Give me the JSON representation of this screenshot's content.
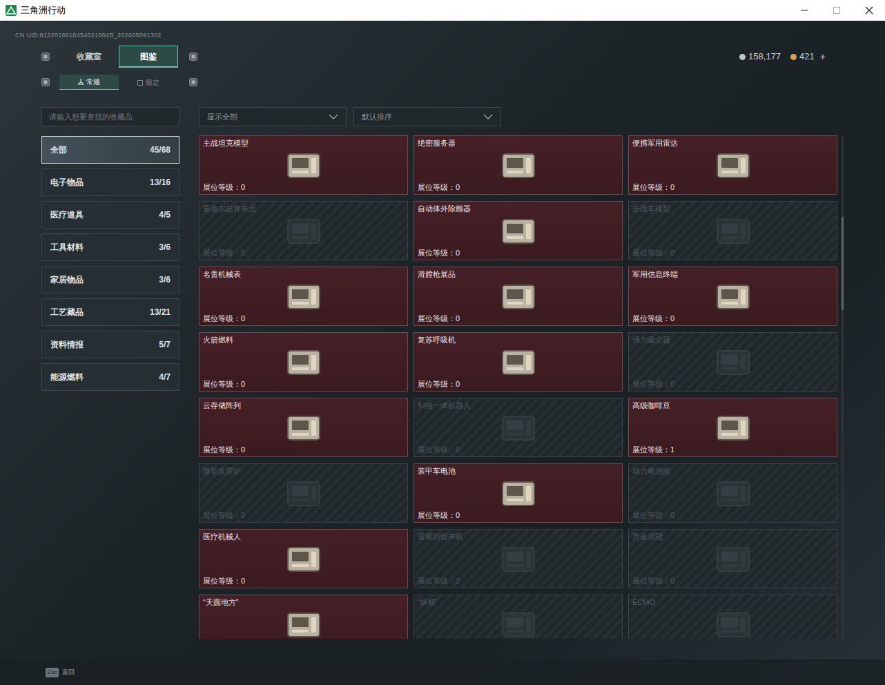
{
  "window": {
    "title": "三角洲行动"
  },
  "uid": "CN UID:8122816818454021804B_202605091302",
  "tabs": [
    {
      "label": "收藏室",
      "selected": false
    },
    {
      "label": "图鉴",
      "selected": true
    }
  ],
  "subtabs": [
    {
      "label": "常规",
      "selected": true
    },
    {
      "label": "限定",
      "selected": false
    }
  ],
  "currency": [
    {
      "amount": "158,177",
      "color": "#c0c4c6"
    },
    {
      "amount": "421",
      "color": "#d8a24a"
    }
  ],
  "currency_add": "+",
  "search": {
    "placeholder": "请输入想要查找的收藏品"
  },
  "filters": [
    {
      "label": "显示全部"
    },
    {
      "label": "默认排序"
    }
  ],
  "categories": [
    {
      "name": "全部",
      "count": "45/68",
      "selected": true
    },
    {
      "name": "电子物品",
      "count": "13/16",
      "selected": false
    },
    {
      "name": "医疗道具",
      "count": "4/5",
      "selected": false
    },
    {
      "name": "工具材料",
      "count": "3/6",
      "selected": false
    },
    {
      "name": "家居物品",
      "count": "3/6",
      "selected": false
    },
    {
      "name": "工艺藏品",
      "count": "13/21",
      "selected": false
    },
    {
      "name": "资料情报",
      "count": "5/7",
      "selected": false
    },
    {
      "name": "能源燃料",
      "count": "4/7",
      "selected": false
    }
  ],
  "items": [
    {
      "name": "主战坦克模型",
      "level": "展位等级：0",
      "collected": true
    },
    {
      "name": "绝密服务器",
      "level": "展位等级：0",
      "collected": true
    },
    {
      "name": "便携军用雷达",
      "level": "展位等级：0",
      "collected": true
    },
    {
      "name": "曼德尔超算单元",
      "level": "展位等级：0",
      "collected": false
    },
    {
      "name": "自动体外除颤器",
      "level": "展位等级：0",
      "collected": true
    },
    {
      "name": "步战车模型",
      "level": "展位等级：0",
      "collected": false
    },
    {
      "name": "名贵机械表",
      "level": "展位等级：0",
      "collected": true
    },
    {
      "name": "滑膛枪展品",
      "level": "展位等级：0",
      "collected": true
    },
    {
      "name": "军用信息终端",
      "level": "展位等级：0",
      "collected": true
    },
    {
      "name": "火箭燃料",
      "level": "展位等级：0",
      "collected": true
    },
    {
      "name": "复苏呼吸机",
      "level": "展位等级：0",
      "collected": true
    },
    {
      "name": "强力吸尘器",
      "level": "展位等级：0",
      "collected": false
    },
    {
      "name": "云存储阵列",
      "level": "展位等级：0",
      "collected": true
    },
    {
      "name": "扫拖一体机器人",
      "level": "展位等级：0",
      "collected": false
    },
    {
      "name": "高级咖啡豆",
      "level": "展位等级：1",
      "collected": true
    },
    {
      "name": "微型反应炉",
      "level": "展位等级：0",
      "collected": false
    },
    {
      "name": "装甲车电池",
      "level": "展位等级：0",
      "collected": true
    },
    {
      "name": "动力电池组",
      "level": "展位等级：0",
      "collected": false
    },
    {
      "name": "医疗机械人",
      "level": "展位等级：0",
      "collected": true
    },
    {
      "name": "雷斯的留声机",
      "level": "展位等级：0",
      "collected": false
    },
    {
      "name": "万金泪冠",
      "level": "展位等级：0",
      "collected": false
    },
    {
      "name": "“天圆地方”",
      "collected": true
    },
    {
      "name": "“纵横”",
      "collected": false
    },
    {
      "name": "ECMO",
      "collected": false
    }
  ],
  "footer": {
    "key": "Esc",
    "label": "返回"
  }
}
